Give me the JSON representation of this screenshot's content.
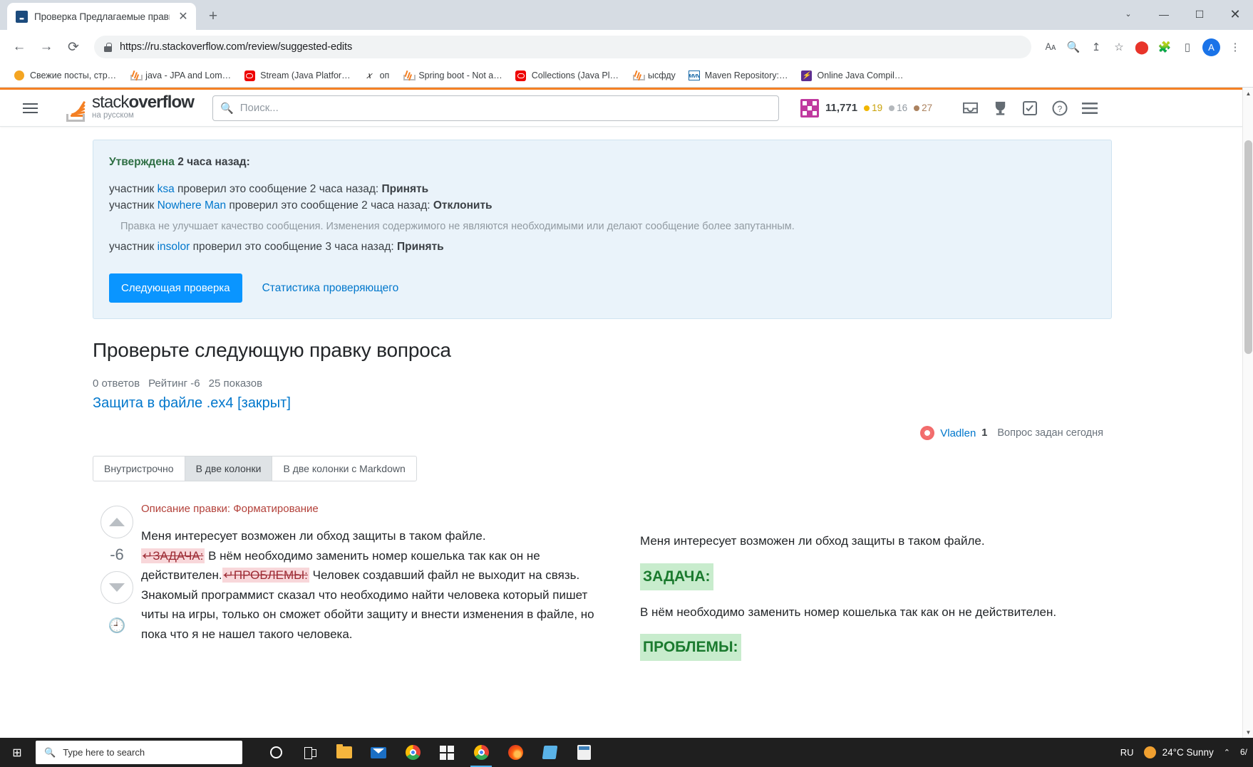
{
  "browser": {
    "tab_title": "Проверка Предлагаемые правк",
    "url": "https://ru.stackoverflow.com/review/suggested-edits",
    "new_tab_label": "+",
    "close_tab_label": "✕",
    "nav": {
      "back": "←",
      "forward": "→",
      "reload": "⟳"
    },
    "window_controls": {
      "more": "⌄",
      "minimize": "—",
      "maximize": "☐",
      "close": "✕"
    },
    "profile_initial": "A",
    "bookmarks": [
      {
        "label": "Свежие посты, стр…",
        "icon": "honey-icon"
      },
      {
        "label": "java - JPA and Lom…",
        "icon": "stackoverflow-icon"
      },
      {
        "label": "Stream (Java Platfor…",
        "icon": "oracle-icon"
      },
      {
        "label": "оп",
        "icon": "math-icon"
      },
      {
        "label": "Spring boot - Not a…",
        "icon": "stackoverflow-icon"
      },
      {
        "label": "Collections (Java Pl…",
        "icon": "oracle-icon"
      },
      {
        "label": "ысфду",
        "icon": "stackoverflow-icon"
      },
      {
        "label": "Maven Repository:…",
        "icon": "maven-icon"
      },
      {
        "label": "Online Java Compil…",
        "icon": "bolt-icon"
      }
    ]
  },
  "site_header": {
    "logo_main": "stack",
    "logo_bold": "overflow",
    "logo_sub": "на русском",
    "search_placeholder": "Поиск...",
    "reputation": "11,771",
    "badges": {
      "gold": "19",
      "silver": "16",
      "bronze": "27"
    },
    "icons": [
      "inbox-icon",
      "trophy-icon",
      "review-icon",
      "help-icon",
      "menu-icon"
    ]
  },
  "review_box": {
    "status_label": "Утверждена",
    "status_time": "2 часа назад:",
    "entries": [
      {
        "prefix": "участник ",
        "user": "ksa",
        "middle": " проверил это сообщение 2 часа назад: ",
        "action": "Принять"
      },
      {
        "prefix": "участник ",
        "user": "Nowhere Man",
        "middle": " проверил это сообщение 2 часа назад: ",
        "action": "Отклонить"
      }
    ],
    "reason": "Правка не улучшает качество сообщения. Изменения содержимого не являются необходимыми или делают сообщение более запутанным.",
    "entry3": {
      "prefix": "участник ",
      "user": "insolor",
      "middle": " проверил это сообщение 3 часа назад: ",
      "action": "Принять"
    },
    "next_button": "Следующая проверка",
    "stats_link": "Статистика проверяющего"
  },
  "main": {
    "page_title": "Проверьте следующую правку вопроса",
    "stats": {
      "answers": "0 ответов",
      "score": "Рейтинг -6",
      "views": "25 показов"
    },
    "question_link": "Защита в файле .ex4 [закрыт]",
    "owner": {
      "name": "Vladlen",
      "rep": "1",
      "when": "Вопрос задан сегодня"
    },
    "view_tabs": [
      {
        "label": "Внутристрочно",
        "active": false
      },
      {
        "label": "В две колонки",
        "active": true
      },
      {
        "label": "В две колонки с Markdown",
        "active": false
      }
    ],
    "vote": {
      "score": "-6",
      "up": "upvote-arrow",
      "down": "downvote-arrow",
      "history": "history-icon"
    },
    "edit_summary": "Описание правки: Форматирование",
    "left": {
      "line1": "Меня интересует возможен ли обход защиты в таком файле.",
      "del1": "ЗАДАЧА:",
      "after_del1": " В нём необходимо заменить номер кошелька так как он не действителен.",
      "del2": "ПРОБЛЕМЫ:",
      "after_del2": " Человек создавший файл не выходит на связь. Знакомый программист сказал что необходимо найти человека который пишет читы на игры, только он сможет обойти защиту и внести изменения в файле, но пока что я не нашел такого человека."
    },
    "right": {
      "line1": "Меня интересует возможен ли обход защиты в таком файле.",
      "head1": "ЗАДАЧА:",
      "para1": "В нём необходимо заменить номер кошелька так как он не действителен.",
      "head2": "ПРОБЛЕМЫ:"
    }
  },
  "taskbar": {
    "search_placeholder": "Type here to search",
    "apps": [
      "cortana-icon",
      "task-view-icon",
      "file-explorer-icon",
      "mail-icon",
      "chrome-icon",
      "microsoft-store-icon",
      "chrome-active-icon",
      "firefox-icon",
      "reader-icon",
      "calculator-icon"
    ],
    "language": "RU",
    "weather": "24°C  Sunny",
    "date": "6/"
  },
  "colors": {
    "accent_orange": "#f48024",
    "link_blue": "#0077cc",
    "button_blue": "#0a95ff",
    "approved_green": "#2f6f44",
    "delete_red": "#f8d7da",
    "insert_green": "#c8eccd"
  }
}
